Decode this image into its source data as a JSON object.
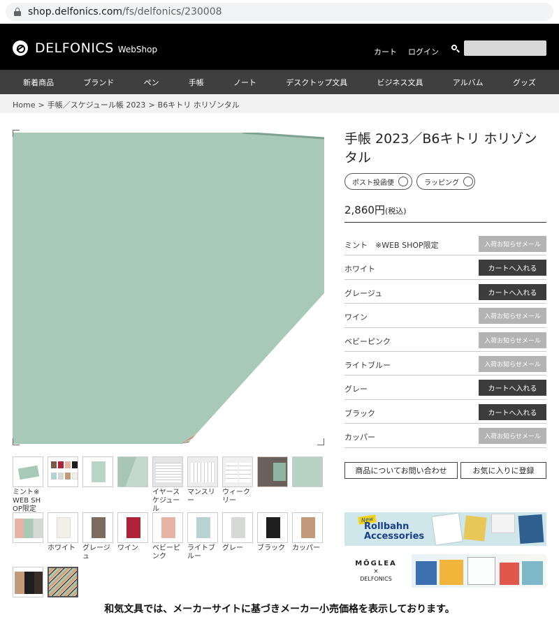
{
  "browser": {
    "url_host": "shop.delfonics.com",
    "url_path": "/fs/delfonics/230008"
  },
  "header": {
    "brand": "DELFONICS",
    "brand_sub": "WebShop",
    "cart": "カート",
    "login": "ログイン",
    "search_placeholder": ""
  },
  "nav": [
    "新着商品",
    "ブランド",
    "ペン",
    "手帳",
    "ノート",
    "デスクトップ文具",
    "ビジネス文具",
    "アルバム",
    "グッズ"
  ],
  "breadcrumb": [
    "Home",
    "手帳／スケジュール帳 2023",
    "B6キトリ ホリゾンタル"
  ],
  "product": {
    "title": "手帳 2023／B6キトリ ホリゾンタル",
    "tags": [
      "ポスト投函便",
      "ラッピング"
    ],
    "price": "2,860円",
    "tax": "(税込)"
  },
  "variants": [
    {
      "name": "ミント　※WEB SHOP限定",
      "button": "入荷お知らせメール",
      "type": "notify"
    },
    {
      "name": "ホワイト",
      "button": "カートへ入れる",
      "type": "cart"
    },
    {
      "name": "グレージュ",
      "button": "カートへ入れる",
      "type": "cart"
    },
    {
      "name": "ワイン",
      "button": "入荷お知らせメール",
      "type": "notify"
    },
    {
      "name": "ベビーピンク",
      "button": "入荷お知らせメール",
      "type": "notify"
    },
    {
      "name": "ライトブルー",
      "button": "入荷お知らせメール",
      "type": "notify"
    },
    {
      "name": "グレー",
      "button": "カートへ入れる",
      "type": "cart"
    },
    {
      "name": "ブラック",
      "button": "カートへ入れる",
      "type": "cart"
    },
    {
      "name": "カッパー",
      "button": "入荷お知らせメール",
      "type": "notify"
    }
  ],
  "actions": {
    "inquiry": "商品についてお問い合わせ",
    "favorite": "お気に入りに登録"
  },
  "thumbnails": [
    {
      "caption": "ミント※WEB SHOP限定",
      "color": "#a8c9b8"
    },
    {
      "caption": "",
      "color": "mixed"
    },
    {
      "caption": "",
      "color": "#b9d4c4"
    },
    {
      "caption": "",
      "color": "#a7c7b4"
    },
    {
      "caption": "イヤースケジュール",
      "color": "#e4e4e4"
    },
    {
      "caption": "マンスリー",
      "color": "#ececec"
    },
    {
      "caption": "ウィークリー",
      "color": "#f0f0f0"
    },
    {
      "caption": "",
      "color": "#6a625a"
    },
    {
      "caption": "",
      "color": "#b7d1c3"
    },
    {
      "caption": "",
      "color": "#c9b7a4"
    },
    {
      "caption": "ホワイト",
      "color": "#f1efe8"
    },
    {
      "caption": "グレージュ",
      "color": "#7c6b5f"
    },
    {
      "caption": "ワイン",
      "color": "#b0213a"
    },
    {
      "caption": "ベビーピンク",
      "color": "#e7b3a4"
    },
    {
      "caption": "ライトブルー",
      "color": "#b6d3d2"
    },
    {
      "caption": "グレー",
      "color": "#d5d8d4"
    },
    {
      "caption": "ブラック",
      "color": "#1e1e1e"
    },
    {
      "caption": "カッパー",
      "color": "#c29a79"
    },
    {
      "caption": "",
      "color": "#3a2e2a"
    },
    {
      "caption": "",
      "color": "#8b8e8a"
    }
  ],
  "banners": {
    "rollbahn_new": "New",
    "rollbahn_line1": "Rollbahn",
    "rollbahn_line2": "Accessories",
    "moglea": "MŌGLEA",
    "x": "×",
    "delfonics": "DELFONICS"
  },
  "footer_note": "和気文具では、メーカーサイトに基づきメーカー小売価格を表示しております。"
}
